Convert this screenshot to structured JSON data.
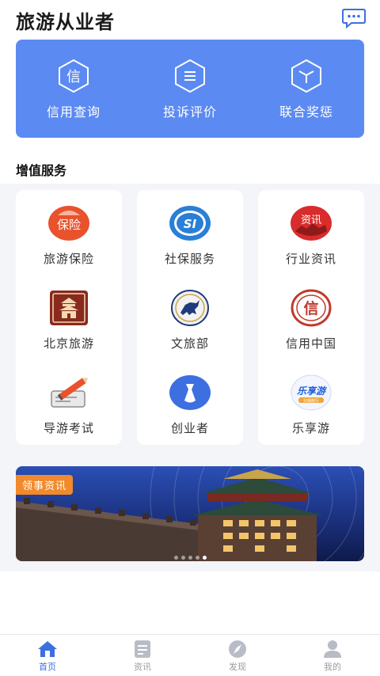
{
  "header": {
    "title": "旅游从业者",
    "message_icon": "chat-bubble-icon"
  },
  "quick_actions": [
    {
      "label": "信用查询",
      "glyph": "信",
      "icon": "credit-hexagon-icon"
    },
    {
      "label": "投诉评价",
      "glyph": "☰",
      "icon": "complaint-hexagon-icon"
    },
    {
      "label": "联合奖惩",
      "glyph": "cube",
      "icon": "cube-hexagon-icon"
    }
  ],
  "section": {
    "title": "增值服务"
  },
  "services": [
    {
      "label": "旅游保险",
      "badge": "保险",
      "icon": "insurance-icon"
    },
    {
      "label": "社保服务",
      "badge": "SI",
      "icon": "social-security-icon"
    },
    {
      "label": "行业资讯",
      "badge": "资讯",
      "icon": "industry-news-icon"
    },
    {
      "label": "北京旅游",
      "badge": "",
      "icon": "beijing-tourism-icon"
    },
    {
      "label": "文旅部",
      "badge": "",
      "icon": "culture-ministry-icon"
    },
    {
      "label": "信用中国",
      "badge": "信",
      "icon": "credit-china-icon"
    },
    {
      "label": "导游考试",
      "badge": "",
      "icon": "guide-exam-icon"
    },
    {
      "label": "创业者",
      "badge": "",
      "icon": "entrepreneur-icon"
    },
    {
      "label": "乐享游",
      "badge": "乐享游",
      "badge_sub": "分期旅行",
      "icon": "lexiangyou-icon"
    }
  ],
  "banner": {
    "tag": "领事资讯",
    "slides": 5,
    "active_slide": 4
  },
  "tabbar": [
    {
      "label": "首页",
      "icon": "home-icon",
      "active": true
    },
    {
      "label": "资讯",
      "icon": "news-icon",
      "active": false
    },
    {
      "label": "发现",
      "icon": "compass-icon",
      "active": false
    },
    {
      "label": "我的",
      "icon": "profile-icon",
      "active": false
    }
  ],
  "colors": {
    "primary": "#5b8af2",
    "accent": "#3d6fe0",
    "tag": "#f08a2c",
    "insurance": "#e8532d",
    "social": "#2a7fd6",
    "news": "#d92c2c"
  }
}
